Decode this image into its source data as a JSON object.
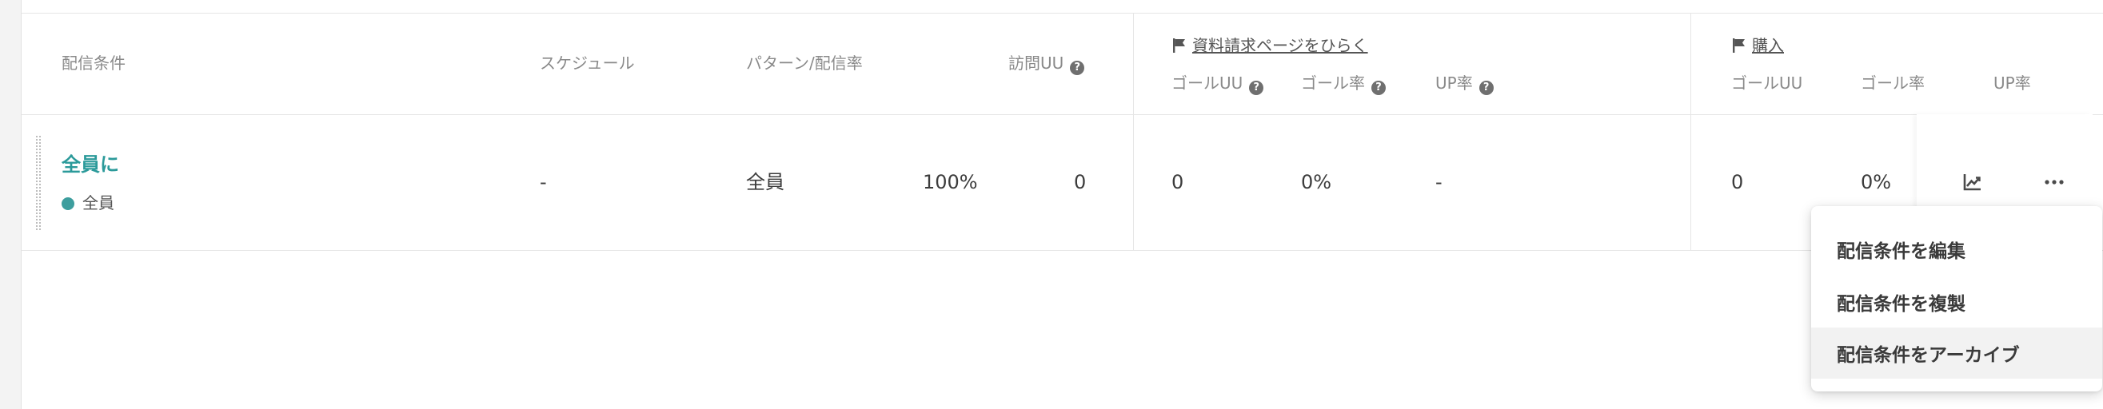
{
  "columns": {
    "condition": "配信条件",
    "schedule": "スケジュール",
    "pattern_rate": "パターン/配信率",
    "visit_uu": "訪問UU"
  },
  "goals": [
    {
      "name": "資料請求ページをひらく",
      "goal_uu_label": "ゴールUU",
      "goal_rate_label": "ゴール率",
      "up_rate_label": "UP率",
      "goal_uu": "0",
      "goal_rate": "0%",
      "up_rate": "-"
    },
    {
      "name": "購入",
      "goal_uu_label": "ゴールUU",
      "goal_rate_label": "ゴール率",
      "up_rate_label": "UP率",
      "goal_uu": "0",
      "goal_rate": "0%",
      "up_rate": ""
    }
  ],
  "row": {
    "condition_name": "全員に",
    "segment": "全員",
    "schedule": "-",
    "pattern": "全員",
    "rate": "100%",
    "visit_uu": "0"
  },
  "menu": {
    "items": [
      "配信条件を編集",
      "配信条件を複製",
      "配信条件をアーカイブ"
    ]
  },
  "icons": {
    "help": "question-circle-icon",
    "flag": "flag-icon",
    "chart": "chart-line-icon",
    "more": "more-horizontal-icon"
  },
  "colors": {
    "accent": "#2b9a9a",
    "segment_dot": "#3d9e9e"
  }
}
